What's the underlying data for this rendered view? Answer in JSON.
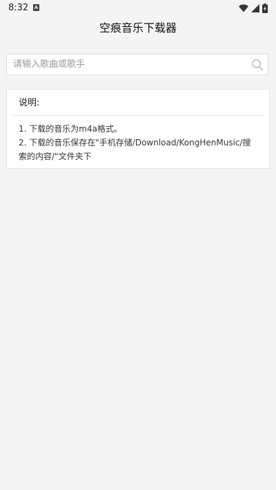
{
  "status_bar": {
    "time": "8:32",
    "notification_icon": "a-icon",
    "icons": [
      "wifi-icon",
      "signal-icon",
      "battery-charging-icon"
    ]
  },
  "app_bar": {
    "title": "空痕音乐下载器"
  },
  "search": {
    "placeholder": "请输入歌曲或歌手",
    "value": "",
    "icon": "search-icon"
  },
  "info": {
    "title": "说明:",
    "lines": [
      "1. 下载的音乐为m4a格式。",
      "2. 下载的音乐保存在\"手机存储/Download/KongHenMusic/搜索的内容/\"文件夹下"
    ]
  },
  "colors": {
    "background": "#f4f4f4",
    "card": "#ffffff",
    "border": "#dedede",
    "text": "#222222",
    "placeholder": "#9a9a9a"
  }
}
